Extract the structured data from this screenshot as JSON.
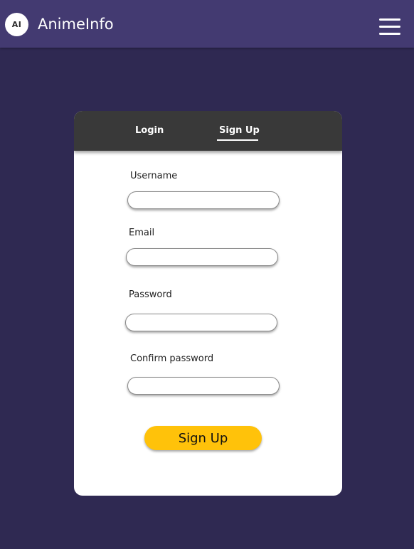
{
  "header": {
    "logo_text": "AI",
    "app_title": "AnimeInfo",
    "menu_icon": "hamburger-menu-icon"
  },
  "auth_card": {
    "tabs": [
      {
        "label": "Login",
        "active": false
      },
      {
        "label": "Sign Up",
        "active": true
      }
    ],
    "fields": [
      {
        "label": "Username",
        "value": "",
        "placeholder": ""
      },
      {
        "label": "Email",
        "value": "",
        "placeholder": ""
      },
      {
        "label": "Password",
        "value": "",
        "placeholder": ""
      },
      {
        "label": "Confirm password",
        "value": "",
        "placeholder": ""
      }
    ],
    "submit_label": "Sign Up"
  },
  "colors": {
    "background": "#2f2952",
    "header": "#433a71",
    "tab_bar": "#393939",
    "card": "#ffffff",
    "button": "#ffc20a"
  }
}
